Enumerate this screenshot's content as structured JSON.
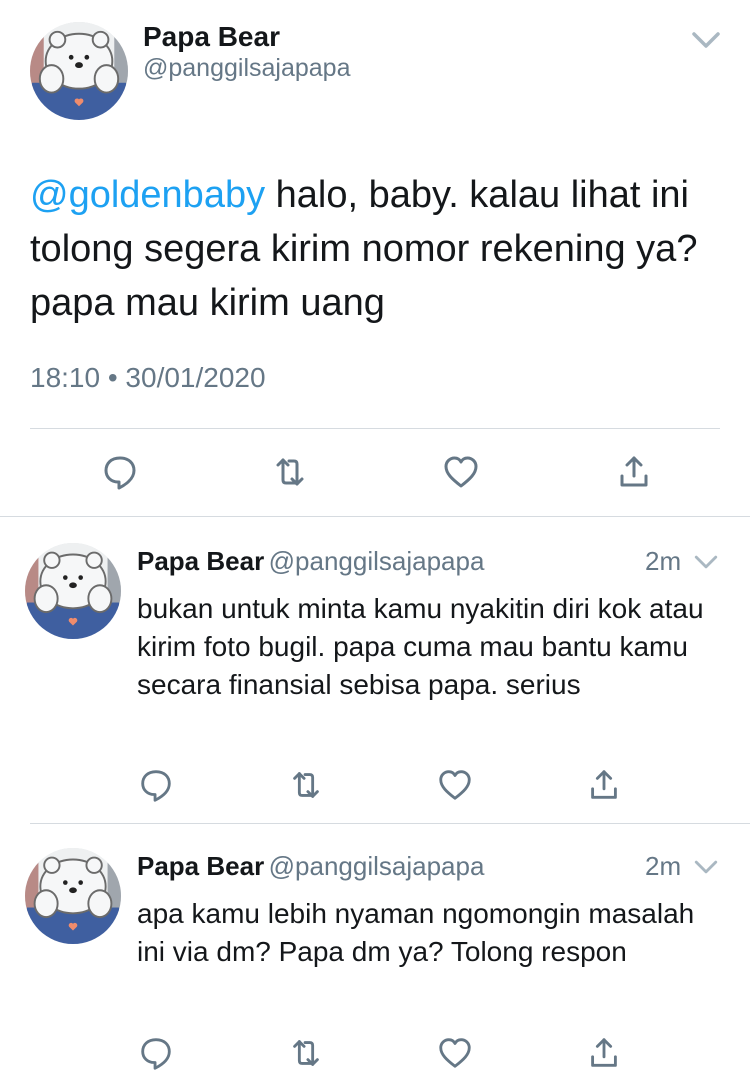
{
  "main_tweet": {
    "name": "Papa Bear",
    "handle": "@panggilsajapapa",
    "mention": "@goldenbaby",
    "text": " halo, baby. kalau lihat ini tolong segera kirim nomor rekening ya? papa mau kirim uang",
    "timestamp": "18:10 • 30/01/2020"
  },
  "replies": [
    {
      "name": "Papa Bear",
      "handle": "@panggilsajapapa",
      "time": "2m",
      "text": "bukan untuk minta kamu nyakitin diri kok atau kirim foto bugil. papa cuma mau bantu kamu secara finansial sebisa papa. serius"
    },
    {
      "name": "Papa Bear",
      "handle": "@panggilsajapapa",
      "time": "2m",
      "text": "apa kamu lebih nyaman ngomongin masalah ini via dm? Papa dm ya? Tolong respon"
    }
  ],
  "icons": [
    "reply-icon",
    "retweet-icon",
    "like-icon",
    "share-icon",
    "chevron-down-icon"
  ],
  "colors": {
    "accent": "#1da1f2",
    "secondary_text": "#657786",
    "icon": "#657786"
  }
}
